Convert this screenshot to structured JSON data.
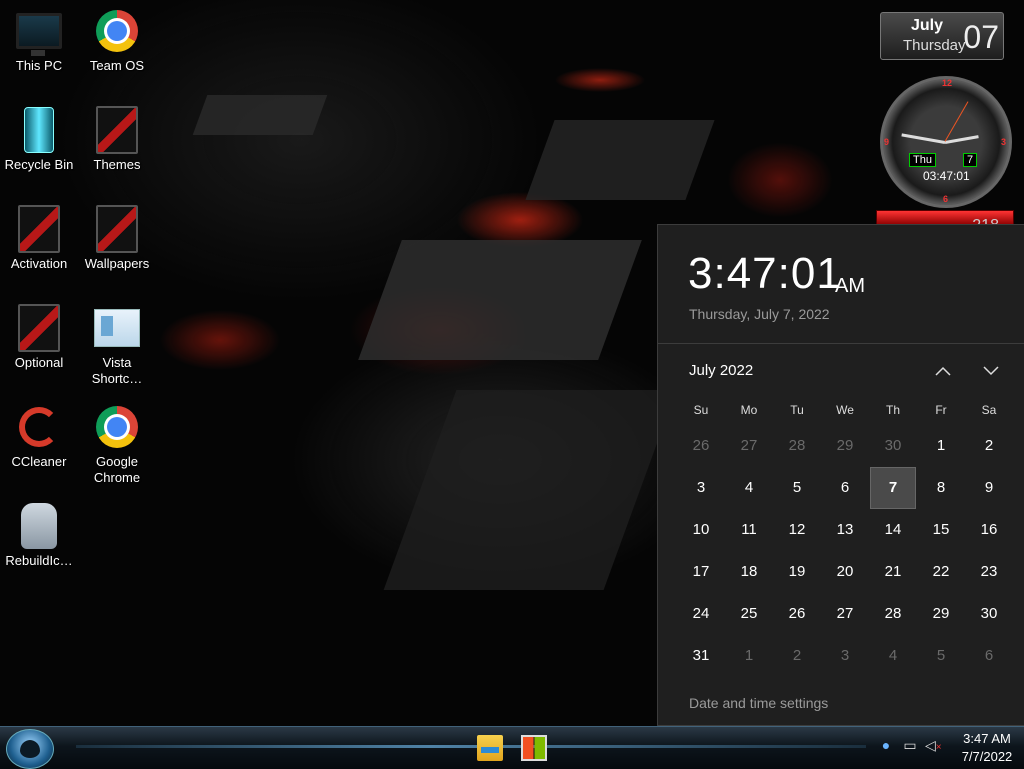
{
  "desktop": {
    "icons": [
      {
        "label": "This PC",
        "icon": "this-pc-icon"
      },
      {
        "label": "Team OS",
        "icon": "chrome-icon"
      },
      {
        "label": "Recycle Bin",
        "icon": "recycle-bin-icon"
      },
      {
        "label": "Themes",
        "icon": "themes-icon"
      },
      {
        "label": "Activation",
        "icon": "activation-icon"
      },
      {
        "label": "Wallpapers",
        "icon": "wallpapers-icon"
      },
      {
        "label": "Optional",
        "icon": "optional-icon"
      },
      {
        "label": "Vista Shortc…",
        "icon": "vista-shortcut-icon"
      },
      {
        "label": "CCleaner",
        "icon": "ccleaner-icon"
      },
      {
        "label": "Google Chrome",
        "icon": "chrome-icon"
      },
      {
        "label": "RebuildIc…",
        "icon": "rebuild-icon-cache-icon"
      }
    ]
  },
  "date_widget": {
    "month": "July",
    "weekday": "Thursday",
    "day": "07"
  },
  "clock_gadget": {
    "numbers": {
      "top": "12",
      "right": "3",
      "bottom": "6",
      "left": "9"
    },
    "day_tag": "Thu",
    "date_tag": "7",
    "time": "03:47:01",
    "lower_readout": "218"
  },
  "flyout": {
    "time": "3:47:01",
    "ampm": "AM",
    "date_long": "Thursday, July 7, 2022",
    "month_label": "July 2022",
    "prev_icon": "chevron-up-icon",
    "next_icon": "chevron-down-icon",
    "days_of_week": [
      "Su",
      "Mo",
      "Tu",
      "We",
      "Th",
      "Fr",
      "Sa"
    ],
    "days": [
      {
        "d": "26",
        "other": true
      },
      {
        "d": "27",
        "other": true
      },
      {
        "d": "28",
        "other": true
      },
      {
        "d": "29",
        "other": true
      },
      {
        "d": "30",
        "other": true
      },
      {
        "d": "1"
      },
      {
        "d": "2"
      },
      {
        "d": "3"
      },
      {
        "d": "4"
      },
      {
        "d": "5"
      },
      {
        "d": "6"
      },
      {
        "d": "7",
        "today": true
      },
      {
        "d": "8"
      },
      {
        "d": "9"
      },
      {
        "d": "10"
      },
      {
        "d": "11"
      },
      {
        "d": "12"
      },
      {
        "d": "13"
      },
      {
        "d": "14"
      },
      {
        "d": "15"
      },
      {
        "d": "16"
      },
      {
        "d": "17"
      },
      {
        "d": "18"
      },
      {
        "d": "19"
      },
      {
        "d": "20"
      },
      {
        "d": "21"
      },
      {
        "d": "22"
      },
      {
        "d": "23"
      },
      {
        "d": "24"
      },
      {
        "d": "25"
      },
      {
        "d": "26"
      },
      {
        "d": "27"
      },
      {
        "d": "28"
      },
      {
        "d": "29"
      },
      {
        "d": "30"
      },
      {
        "d": "31"
      },
      {
        "d": "1",
        "other": true
      },
      {
        "d": "2",
        "other": true
      },
      {
        "d": "3",
        "other": true
      },
      {
        "d": "4",
        "other": true
      },
      {
        "d": "5",
        "other": true
      },
      {
        "d": "6",
        "other": true
      }
    ],
    "settings_link": "Date and time settings"
  },
  "taskbar": {
    "pinned": [
      {
        "name": "file-explorer-button",
        "icon": "folder-icon"
      },
      {
        "name": "microsoft-store-button",
        "icon": "store-icon"
      }
    ],
    "tray": {
      "icons": [
        "people-icon",
        "network-icon",
        "volume-muted-icon"
      ],
      "time": "3:47 AM",
      "date": "7/7/2022"
    }
  },
  "colors": {
    "accent_red": "#e02a1a",
    "flyout_bg": "#1f1f1f",
    "today_bg": "#4a4a4a"
  }
}
